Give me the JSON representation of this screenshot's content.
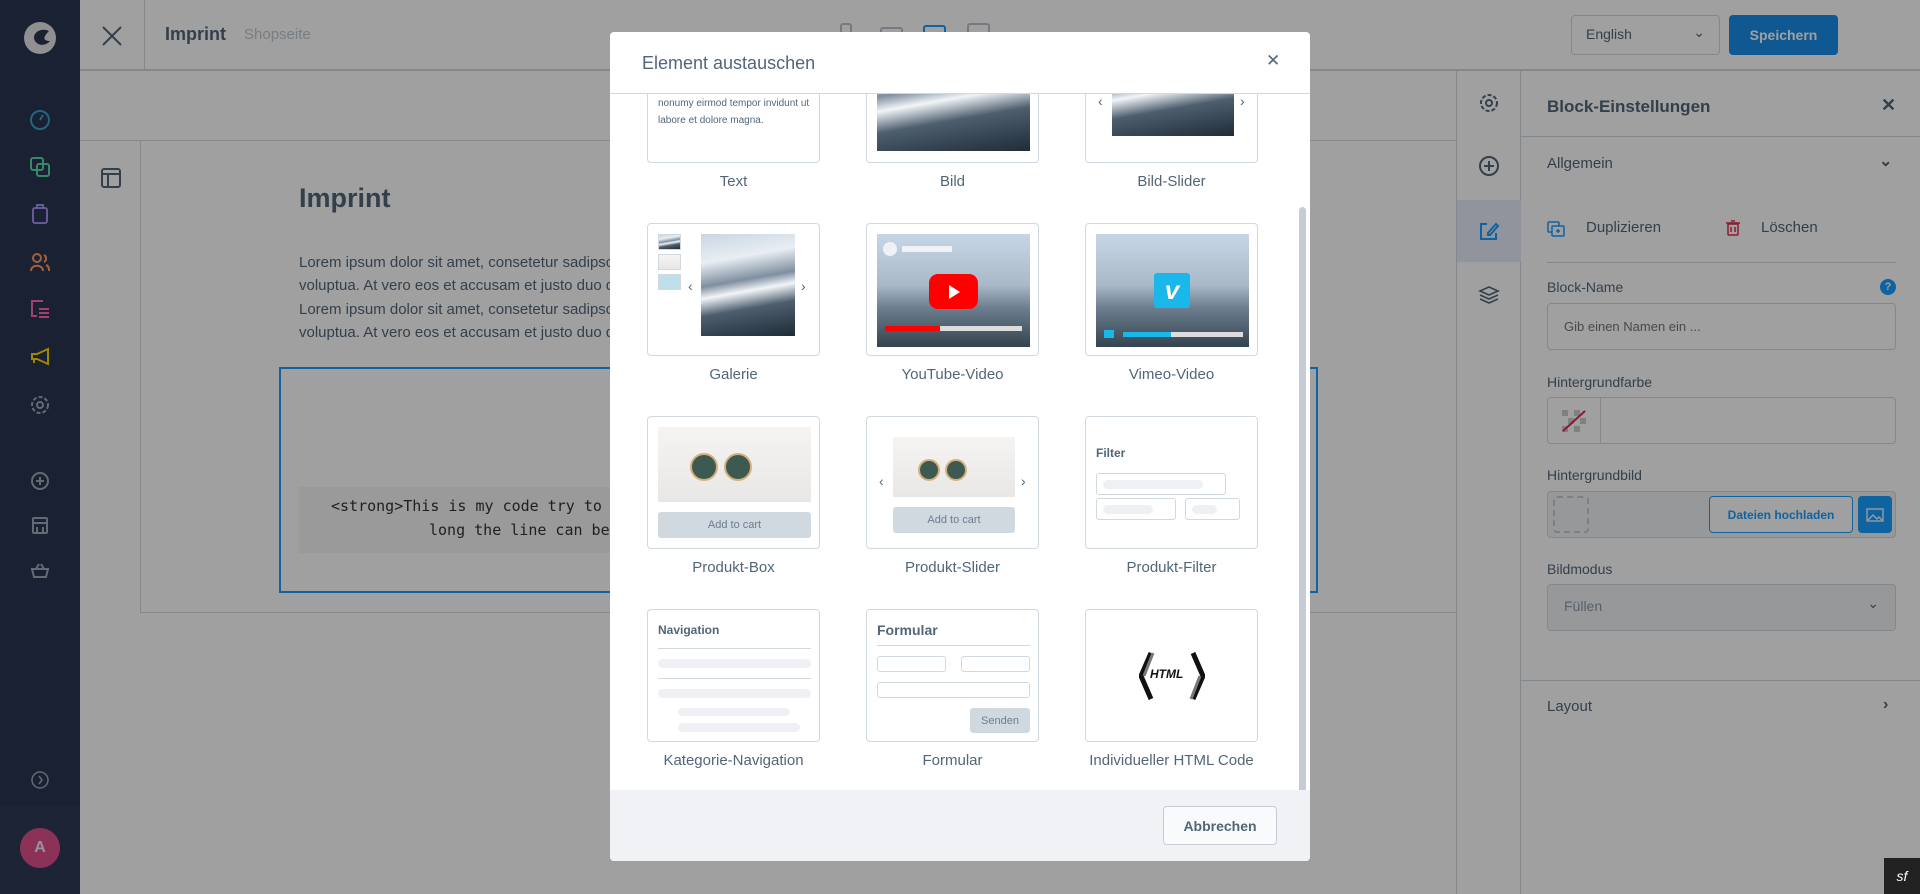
{
  "sidebar": {
    "avatar_initial": "A",
    "icons": [
      "shopware-logo-icon",
      "dashboard-icon",
      "catalogue-icon",
      "orders-icon",
      "customers-icon",
      "content-icon",
      "marketing-icon",
      "settings-icon",
      "add-extension-icon",
      "sales-channel-icon",
      "basket-icon",
      "expand-icon"
    ],
    "accent_colors": {
      "dashboard": "#36a2c9",
      "catalogue": "#57d9a3",
      "orders": "#a092f0",
      "customers": "#ff9d5c",
      "content": "#ff68b4",
      "marketing": "#ffd700"
    }
  },
  "header": {
    "title": "Imprint",
    "subtitle": "Shopseite",
    "language": "English",
    "save_label": "Speichern"
  },
  "page": {
    "heading": "Imprint",
    "lines": [
      "Lorem ipsum dolor sit amet, consetetur sadipscing",
      "voluptua. At vero eos et accusam et justo duo dolores",
      "Lorem ipsum dolor sit amet, consetetur sadipscing",
      "voluptua. At vero eos et accusam et justo duo dolores"
    ],
    "code_lines": [
      "<strong>This is my code try to",
      "long the line can be"
    ]
  },
  "settings": {
    "title": "Block-Einstellungen",
    "section_general": "Allgemein",
    "duplicate": "Duplizieren",
    "delete": "Löschen",
    "block_name_label": "Block-Name",
    "block_name_placeholder": "Gib einen Namen ein ...",
    "bg_color_label": "Hintergrundfarbe",
    "bg_image_label": "Hintergrundbild",
    "upload_label": "Dateien hochladen",
    "image_mode_label": "Bildmodus",
    "image_mode_value": "Füllen",
    "section_layout": "Layout"
  },
  "modal": {
    "title": "Element austauschen",
    "cancel_label": "Abbrechen",
    "text_preview": "nonumy eirmod tempor invidunt ut labore et dolore magna.",
    "items": [
      "Text",
      "Bild",
      "Bild-Slider",
      "Galerie",
      "YouTube-Video",
      "Vimeo-Video",
      "Produkt-Box",
      "Produkt-Slider",
      "Produkt-Filter",
      "Kategorie-Navigation",
      "Formular",
      "Individueller HTML Code"
    ],
    "add_to_cart": "Add to cart",
    "filter_title": "Filter",
    "navigation_title": "Navigation",
    "form_title": "Formular",
    "form_submit": "Senden",
    "html_badge": "HTML"
  },
  "colors": {
    "primary": "#189eff",
    "save_button": "#1a8ce8",
    "delete": "#de294c"
  }
}
